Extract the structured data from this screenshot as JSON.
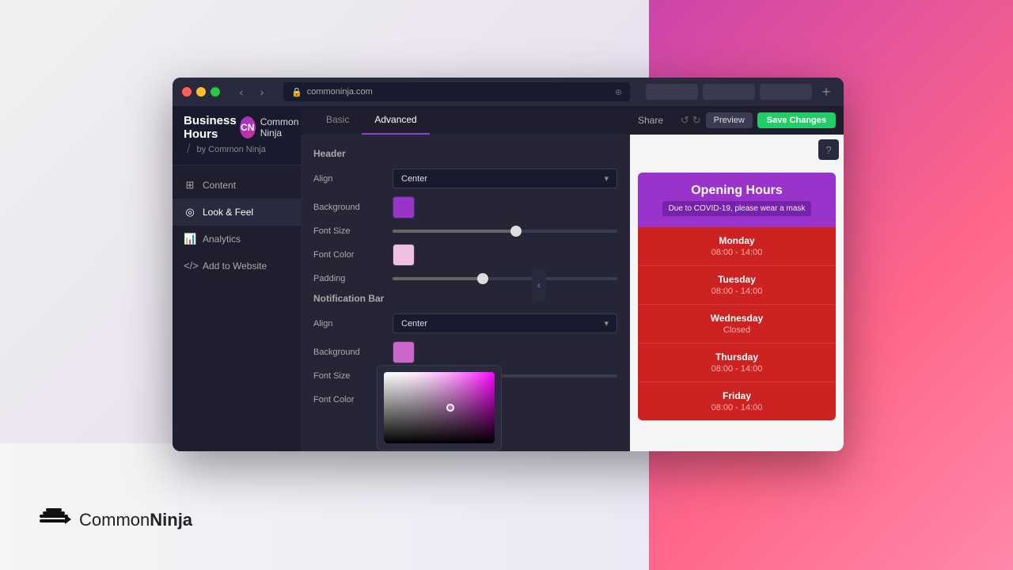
{
  "browser": {
    "url": "commoninja.com",
    "new_tab_label": "+"
  },
  "app": {
    "title": "Business Hours",
    "separator": "/",
    "subtitle": "by Common Ninja",
    "user_name": "Common Ninja",
    "user_initials": "CN"
  },
  "sidebar": {
    "items": [
      {
        "id": "content",
        "label": "Content",
        "icon": "⊞"
      },
      {
        "id": "look-feel",
        "label": "Look & Feel",
        "icon": "◎",
        "active": true
      },
      {
        "id": "analytics",
        "label": "Analytics",
        "icon": "📊"
      },
      {
        "id": "add-website",
        "label": "Add to Website",
        "icon": "<>"
      }
    ]
  },
  "tabs": [
    {
      "id": "basic",
      "label": "Basic",
      "active": false
    },
    {
      "id": "advanced",
      "label": "Advanced",
      "active": true
    }
  ],
  "header_section": {
    "title": "Header",
    "align_label": "Align",
    "align_value": "Center",
    "background_label": "Background",
    "background_color": "#9933cc",
    "font_size_label": "Font Size",
    "font_size_value": 55,
    "font_color_label": "Font Color",
    "font_color": "#f0c0e0",
    "padding_label": "Padding",
    "padding_value": 40
  },
  "notification_section": {
    "title": "Notification Bar",
    "align_label": "Align",
    "align_value": "Center",
    "background_label": "Background",
    "background_color": "#cc66cc",
    "font_size_label": "Font Size",
    "font_size_value": 45,
    "font_color_label": "Font Color",
    "font_color": "#ffffff"
  },
  "preview": {
    "share_label": "Share",
    "preview_button": "Preview",
    "save_button": "Save Changes",
    "help_icon": "?",
    "widget": {
      "header_title": "Opening Hours",
      "header_subtitle": "Due to COVID-19, please wear a mask",
      "days": [
        {
          "day": "Monday",
          "hours": "08:00 - 14:00"
        },
        {
          "day": "Tuesday",
          "hours": "08:00 - 14:00"
        },
        {
          "day": "Wednesday",
          "hours": "Closed"
        },
        {
          "day": "Thursday",
          "hours": "08:00 - 14:00"
        },
        {
          "day": "Friday",
          "hours": "08:00 - 14:00"
        }
      ]
    }
  },
  "brand": {
    "name_light": "Common",
    "name_bold": "Ninja"
  }
}
